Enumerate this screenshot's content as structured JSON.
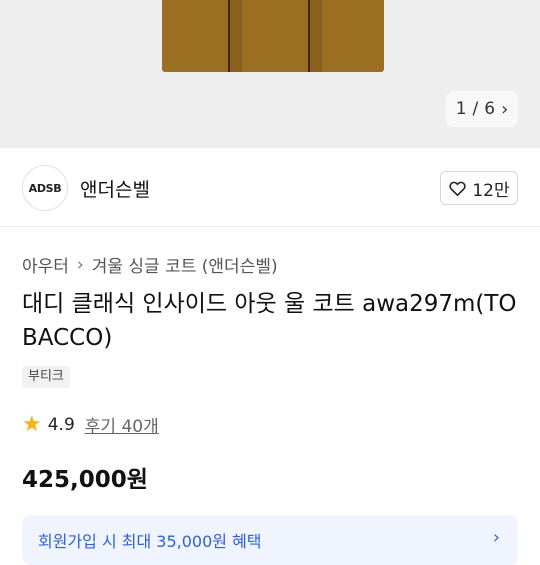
{
  "gallery": {
    "current": "1",
    "separator": "/",
    "total": "6"
  },
  "brand": {
    "logo_text": "ADSB",
    "name": "앤더슨벨",
    "like_count": "12만"
  },
  "breadcrumb": {
    "category": "아우터",
    "subcategory": "겨울 싱글 코트 (앤더슨벨)"
  },
  "product": {
    "title": "대디 클래식 인사이드 아웃 울 코트 awa297m(TOBACCO)",
    "tag": "부티크",
    "rating": "4.9",
    "reviews": "후기 40개",
    "price": "425,000원"
  },
  "benefit": {
    "text": "회원가입 시 최대 35,000원 혜택"
  },
  "colors": {
    "coat": "#9a6f22",
    "star": "#f6b21b",
    "benefit_text": "#3060d6"
  },
  "icons": [
    "chevron-right-icon",
    "heart-icon",
    "star-icon"
  ]
}
